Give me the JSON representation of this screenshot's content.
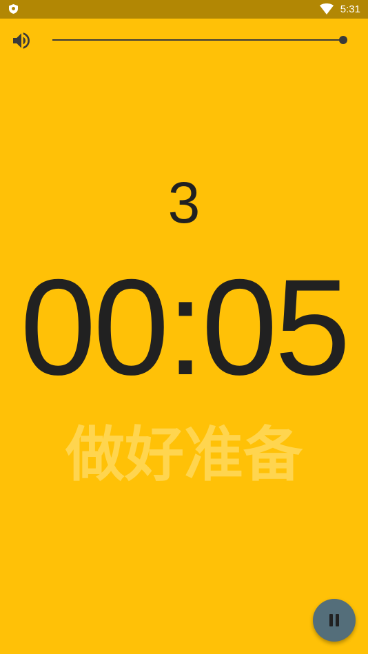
{
  "status_bar": {
    "time": "5:31",
    "left_icon": "shield-icon",
    "signal_icon": "wifi-icon"
  },
  "volume": {
    "icon": "volume-icon",
    "level": 1.0
  },
  "workout": {
    "round": "3",
    "timer": "00:05",
    "phase": "做好准备"
  },
  "controls": {
    "pause_icon": "pause-icon"
  },
  "colors": {
    "background": "#FFC107",
    "status_bar": "#B28704",
    "text": "#212121",
    "phase_text": "#FFD54F",
    "fab": "#546E7A"
  }
}
